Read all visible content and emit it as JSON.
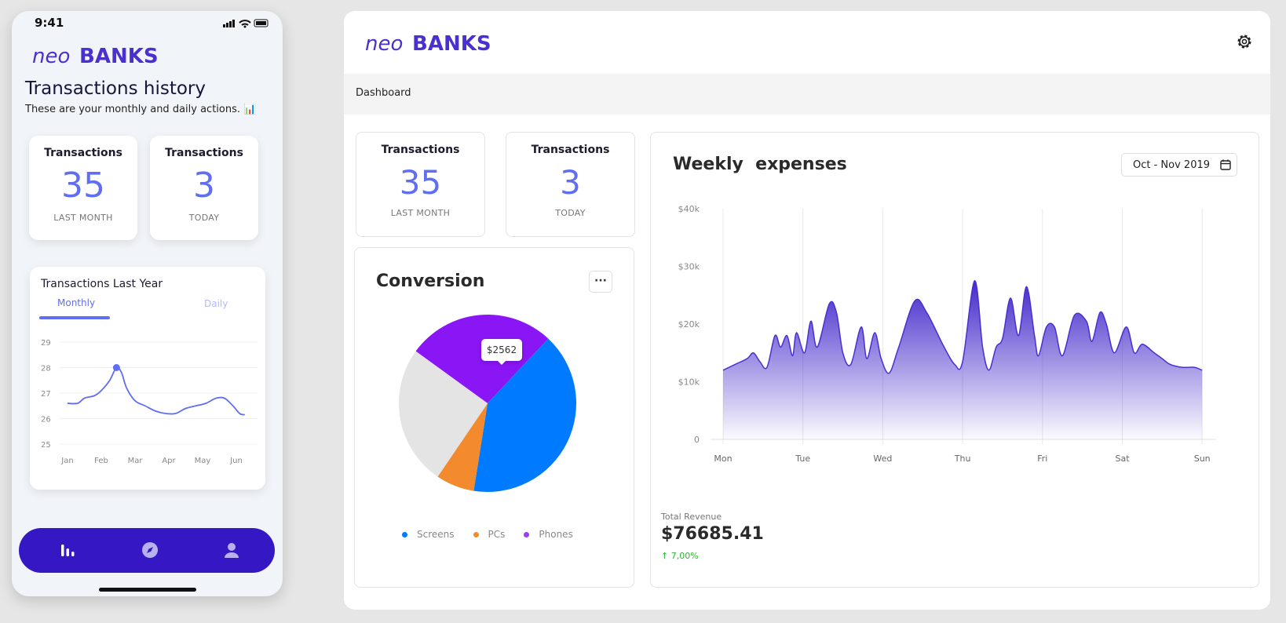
{
  "brand": {
    "prefix": "neo",
    "name": "BANKS",
    "accent": "#4a2fd1"
  },
  "phone": {
    "status": {
      "time": "9:41"
    },
    "title": "Transactions history",
    "subtitle": "These are your monthly and daily actions. 📊",
    "cards": [
      {
        "title": "Transactions",
        "value": "35",
        "label": "LAST MONTH"
      },
      {
        "title": "Transactions",
        "value": "3",
        "label": "TODAY"
      }
    ],
    "chart": {
      "title": "Transactions Last Year",
      "tabs": [
        "Monthly",
        "Daily"
      ],
      "active_tab": "Monthly"
    },
    "nav": [
      "chart-icon",
      "compass-icon",
      "user-icon"
    ]
  },
  "dashboard": {
    "breadcrumb": "Dashboard",
    "cards": [
      {
        "title": "Transactions",
        "value": "35",
        "label": "LAST MONTH"
      },
      {
        "title": "Transactions",
        "value": "3",
        "label": "TODAY"
      }
    ],
    "conversion": {
      "title": "Conversion",
      "more": "···",
      "tooltip": "$2562"
    },
    "weekly": {
      "title": "Weekly  expenses",
      "date_range": "Oct - Nov 2019",
      "total_revenue_label": "Total Revenue",
      "total_revenue": "$76685.41",
      "delta": "7,00%"
    }
  },
  "chart_data": [
    {
      "type": "line",
      "title": "Transactions Last Year",
      "x": [
        "Jan",
        "Feb",
        "Mar",
        "Apr",
        "May",
        "Jun"
      ],
      "y_ticks": [
        25,
        26,
        27,
        28,
        29
      ],
      "ylim": [
        25,
        29
      ],
      "points": [
        [
          0,
          26.6
        ],
        [
          0.3,
          26.6
        ],
        [
          0.5,
          26.8
        ],
        [
          0.8,
          26.9
        ],
        [
          1.0,
          27.1
        ],
        [
          1.25,
          27.5
        ],
        [
          1.45,
          28.0
        ],
        [
          1.6,
          27.8
        ],
        [
          1.75,
          27.2
        ],
        [
          2.0,
          26.7
        ],
        [
          2.3,
          26.5
        ],
        [
          2.6,
          26.3
        ],
        [
          2.9,
          26.2
        ],
        [
          3.2,
          26.2
        ],
        [
          3.5,
          26.4
        ],
        [
          3.8,
          26.5
        ],
        [
          4.1,
          26.6
        ],
        [
          4.4,
          26.8
        ],
        [
          4.65,
          26.8
        ],
        [
          4.9,
          26.5
        ],
        [
          5.1,
          26.2
        ],
        [
          5.25,
          26.15
        ]
      ],
      "highlight": [
        1.45,
        28.0
      ],
      "color": "#5f6ef2"
    },
    {
      "type": "pie",
      "title": "Conversion",
      "legend": [
        "Screens",
        "PCs",
        "Phones"
      ],
      "slices": [
        {
          "name": "Phones",
          "value": 27,
          "color": "#8a16f5"
        },
        {
          "name": "Screens",
          "value": 40.5,
          "color": "#007bff"
        },
        {
          "name": "PCs",
          "value": 7,
          "color": "#f38b2e"
        },
        {
          "name": "",
          "value": 25.5,
          "color": "#e4e4e4"
        }
      ],
      "legend_colors": [
        "#007bff",
        "#f38b2e",
        "#9b3df0"
      ]
    },
    {
      "type": "area",
      "title": "Weekly  expenses",
      "categories": [
        "Mon",
        "Tue",
        "Wed",
        "Thu",
        "Fri",
        "Sat",
        "Sun"
      ],
      "y_ticks": [
        "0",
        "$10k",
        "$20k",
        "$30k",
        "$40k"
      ],
      "ylim": [
        0,
        40000
      ],
      "values": [
        [
          0,
          12000
        ],
        [
          0.15,
          13000
        ],
        [
          0.3,
          14000
        ],
        [
          0.38,
          15000
        ],
        [
          0.46,
          13500
        ],
        [
          0.55,
          12500
        ],
        [
          0.65,
          18000
        ],
        [
          0.72,
          16000
        ],
        [
          0.8,
          18000
        ],
        [
          0.87,
          14500
        ],
        [
          0.92,
          18500
        ],
        [
          1.02,
          15000
        ],
        [
          1.1,
          20500
        ],
        [
          1.18,
          16000
        ],
        [
          1.33,
          23500
        ],
        [
          1.42,
          22000
        ],
        [
          1.5,
          15000
        ],
        [
          1.6,
          13000
        ],
        [
          1.73,
          19500
        ],
        [
          1.8,
          14000
        ],
        [
          1.9,
          18500
        ],
        [
          1.98,
          14000
        ],
        [
          2.08,
          11500
        ],
        [
          2.2,
          16000
        ],
        [
          2.4,
          24000
        ],
        [
          2.55,
          22000
        ],
        [
          2.75,
          16500
        ],
        [
          2.9,
          13000
        ],
        [
          3.0,
          13500
        ],
        [
          3.15,
          27500
        ],
        [
          3.25,
          16000
        ],
        [
          3.33,
          12000
        ],
        [
          3.42,
          16000
        ],
        [
          3.5,
          17500
        ],
        [
          3.6,
          24500
        ],
        [
          3.7,
          18000
        ],
        [
          3.8,
          26500
        ],
        [
          3.9,
          18000
        ],
        [
          3.95,
          14500
        ],
        [
          4.05,
          19500
        ],
        [
          4.15,
          19500
        ],
        [
          4.25,
          14500
        ],
        [
          4.4,
          21500
        ],
        [
          4.55,
          20500
        ],
        [
          4.62,
          17000
        ],
        [
          4.72,
          22000
        ],
        [
          4.8,
          20000
        ],
        [
          4.9,
          15000
        ],
        [
          5.05,
          19500
        ],
        [
          5.15,
          15000
        ],
        [
          5.25,
          16500
        ],
        [
          5.4,
          15000
        ],
        [
          5.5,
          14000
        ],
        [
          5.6,
          13000
        ],
        [
          5.75,
          12500
        ],
        [
          5.9,
          12500
        ],
        [
          6.0,
          12000
        ]
      ],
      "color": "#4a2fd1"
    }
  ]
}
